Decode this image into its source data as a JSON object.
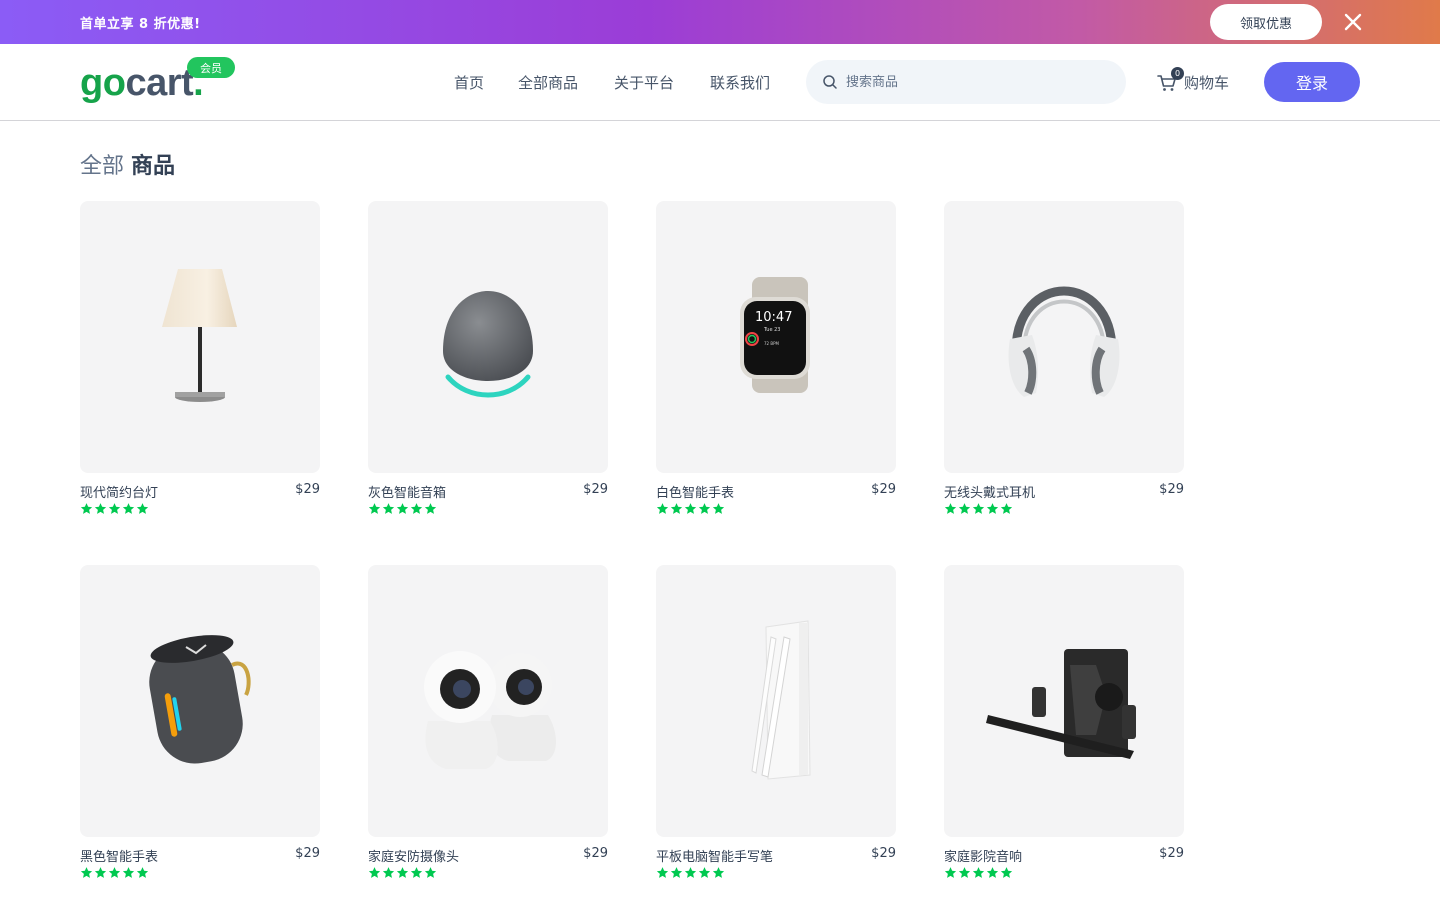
{
  "promo": {
    "text": "首单立享 8 折优惠!",
    "button": "领取优惠"
  },
  "header": {
    "logo_main": "go",
    "logo_rest": "cart",
    "logo_dot": ".",
    "badge": "会员",
    "nav": [
      "首页",
      "全部商品",
      "关于平台",
      "联系我们"
    ],
    "search_placeholder": "搜索商品",
    "cart_label": "购物车",
    "cart_count": "0",
    "login": "登录"
  },
  "page": {
    "title_light": "全部",
    "title_bold": "商品"
  },
  "colors": {
    "accent": "#6366f1",
    "brand_green": "#16a34a",
    "star": "#00c950"
  },
  "products": [
    {
      "name": "现代简约台灯",
      "price": "$29",
      "rating": 5,
      "icon": "lamp"
    },
    {
      "name": "灰色智能音箱",
      "price": "$29",
      "rating": 5,
      "icon": "smart-speaker"
    },
    {
      "name": "白色智能手表",
      "price": "$29",
      "rating": 5,
      "icon": "smartwatch"
    },
    {
      "name": "无线头戴式耳机",
      "price": "$29",
      "rating": 5,
      "icon": "headphones"
    },
    {
      "name": "黑色智能手表",
      "price": "$29",
      "rating": 5,
      "icon": "bluetooth-speaker"
    },
    {
      "name": "家庭安防摄像头",
      "price": "$29",
      "rating": 5,
      "icon": "security-camera"
    },
    {
      "name": "平板电脑智能手写笔",
      "price": "$29",
      "rating": 5,
      "icon": "stylus-pen"
    },
    {
      "name": "家庭影院音响",
      "price": "$29",
      "rating": 5,
      "icon": "home-theater"
    }
  ],
  "watch_face": {
    "time": "10:47",
    "date": "Tue 23",
    "bpm": "72 BPM"
  }
}
